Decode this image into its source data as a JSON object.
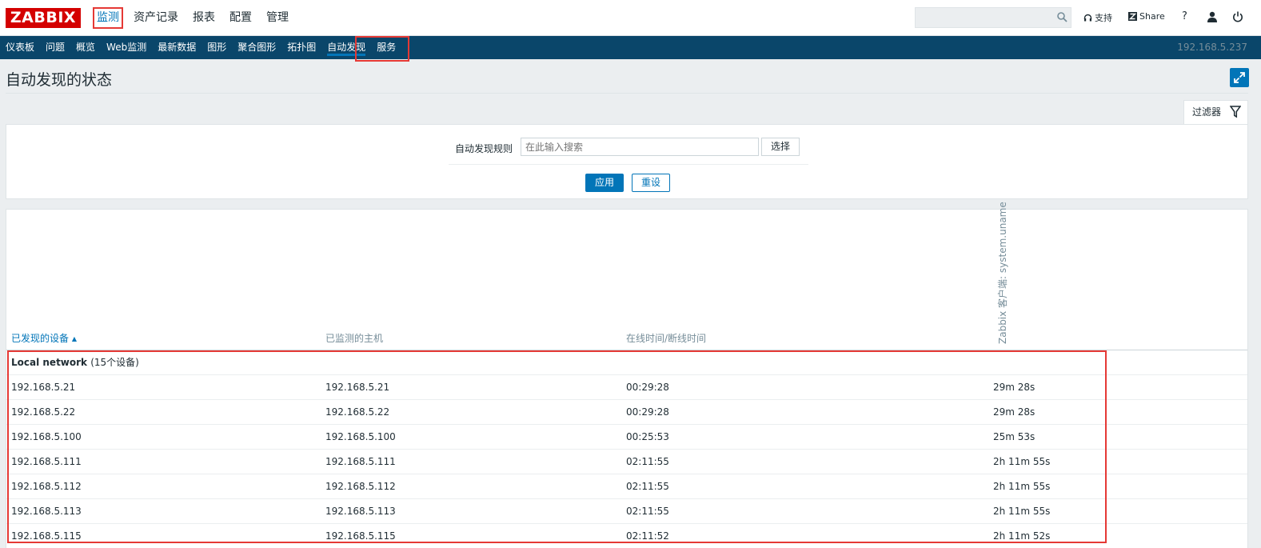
{
  "header": {
    "logo": "ZABBIX",
    "menu": [
      "监测",
      "资产记录",
      "报表",
      "配置",
      "管理"
    ],
    "active_menu_index": 0,
    "support_label": "支持",
    "share_label": "Share",
    "help_label": "?",
    "search_value": ""
  },
  "nav": {
    "items": [
      "仪表板",
      "问题",
      "概览",
      "Web监测",
      "最新数据",
      "图形",
      "聚合图形",
      "拓扑图",
      "自动发现",
      "服务"
    ],
    "active_index": 8,
    "server_ip": "192.168.5.237"
  },
  "page": {
    "title": "自动发现的状态"
  },
  "filter": {
    "tab_label": "过滤器",
    "rule_label": "自动发现规则",
    "rule_placeholder": "在此输入搜索",
    "select_label": "选择",
    "apply_label": "应用",
    "reset_label": "重设"
  },
  "table": {
    "columns": {
      "device": "已发现的设备",
      "host": "已监测的主机",
      "uptime": "在线时间/断线时间",
      "check": "Zabbix 客户端: system.uname"
    },
    "sort_column": "device",
    "sort_dir": "asc",
    "group": {
      "name": "Local network",
      "count_label": "(15个设备)"
    },
    "rows": [
      {
        "device": "192.168.5.21",
        "host": "192.168.5.21",
        "uptime": "00:29:28",
        "check": "29m 28s"
      },
      {
        "device": "192.168.5.22",
        "host": "192.168.5.22",
        "uptime": "00:29:28",
        "check": "29m 28s"
      },
      {
        "device": "192.168.5.100",
        "host": "192.168.5.100",
        "uptime": "00:25:53",
        "check": "25m 53s"
      },
      {
        "device": "192.168.5.111",
        "host": "192.168.5.111",
        "uptime": "02:11:55",
        "check": "2h 11m 55s"
      },
      {
        "device": "192.168.5.112",
        "host": "192.168.5.112",
        "uptime": "02:11:55",
        "check": "2h 11m 55s"
      },
      {
        "device": "192.168.5.113",
        "host": "192.168.5.113",
        "uptime": "02:11:55",
        "check": "2h 11m 55s"
      },
      {
        "device": "192.168.5.115",
        "host": "192.168.5.115",
        "uptime": "02:11:52",
        "check": "2h 11m 52s"
      }
    ]
  },
  "colors": {
    "brand_red": "#d40000",
    "nav_bg": "#0a466a",
    "accent_blue": "#0275b8",
    "highlight_red": "#e53935"
  }
}
